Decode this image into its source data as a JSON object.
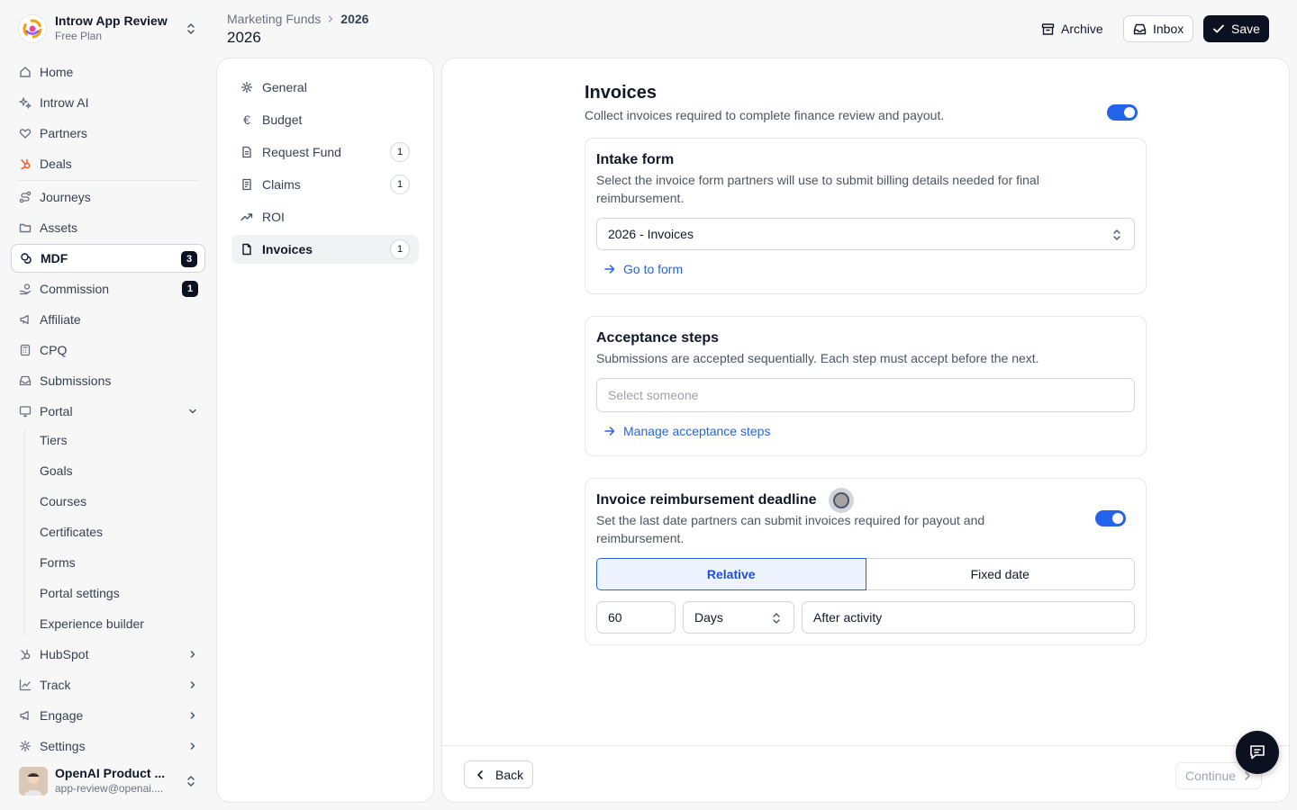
{
  "workspace": {
    "name": "Introw App Review",
    "plan": "Free Plan"
  },
  "nav": {
    "home": "Home",
    "ai": "Introw AI",
    "partners": "Partners",
    "deals": "Deals",
    "journeys": "Journeys",
    "assets": "Assets",
    "mdf": {
      "label": "MDF",
      "badge": "3"
    },
    "commission": {
      "label": "Commission",
      "badge": "1"
    },
    "affiliate": "Affiliate",
    "cpq": "CPQ",
    "submissions": "Submissions",
    "portal": "Portal",
    "portal_items": [
      "Tiers",
      "Goals",
      "Courses",
      "Certificates",
      "Forms",
      "Portal settings",
      "Experience builder"
    ],
    "hubspot": "HubSpot",
    "track": "Track",
    "engage": "Engage",
    "settings": "Settings"
  },
  "user": {
    "name": "OpenAI Product ...",
    "email": "app-review@openai...."
  },
  "breadcrumb": {
    "parent": "Marketing Funds",
    "current": "2026"
  },
  "page_title": "2026",
  "toolbar": {
    "archive": "Archive",
    "inbox": "Inbox",
    "save": "Save"
  },
  "settings_nav": [
    {
      "label": "General",
      "icon": "gear-icon"
    },
    {
      "label": "Budget",
      "icon": "euro-icon"
    },
    {
      "label": "Request Fund",
      "icon": "document-icon",
      "count": "1"
    },
    {
      "label": "Claims",
      "icon": "receipt-icon",
      "count": "1"
    },
    {
      "label": "ROI",
      "icon": "trending-up-icon"
    },
    {
      "label": "Invoices",
      "icon": "file-icon",
      "count": "1",
      "active": true
    }
  ],
  "invoices": {
    "title": "Invoices",
    "description": "Collect invoices required to complete finance review and payout.",
    "enabled": true,
    "intake": {
      "title": "Intake form",
      "description": "Select the invoice form partners will use to submit billing details needed for final reimbursement.",
      "selected_form": "2026 - Invoices",
      "link": "Go to form"
    },
    "acceptance": {
      "title": "Acceptance steps",
      "description": "Submissions are accepted sequentially. Each step must accept before the next.",
      "placeholder": "Select someone",
      "link": "Manage acceptance steps"
    },
    "deadline": {
      "title": "Invoice reimbursement deadline",
      "description": "Set the last date partners can submit invoices required for payout and reimbursement.",
      "enabled": true,
      "mode_options": [
        "Relative",
        "Fixed date"
      ],
      "selected_mode": "Relative",
      "amount": "60",
      "unit": "Days",
      "anchor": "After activity"
    }
  },
  "footer": {
    "back": "Back",
    "continue": "Continue"
  },
  "colors": {
    "accent": "#2563eb",
    "dark": "#0b1120",
    "deals_icon": "#ff5c35"
  }
}
